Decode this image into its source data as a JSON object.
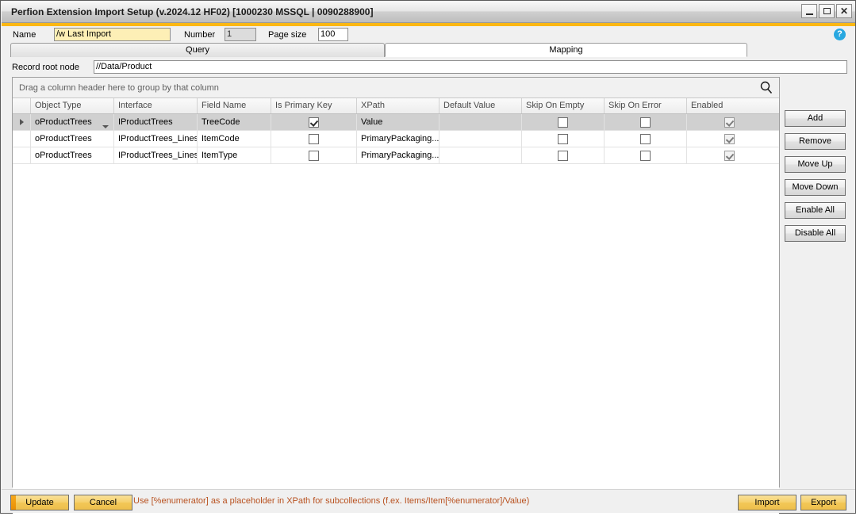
{
  "window": {
    "title": "Perfion Extension Import Setup (v.2024.12 HF02) [1000230 MSSQL | 0090288900]",
    "minimize_label": "Minimize",
    "maximize_label": "Maximize",
    "close_label": "✕",
    "accent_color": "#fbb713"
  },
  "toolbar": {
    "name_label": "Name",
    "name_value": "/w Last Import",
    "number_label": "Number",
    "number_value": "1",
    "page_size_label": "Page size",
    "page_size_value": "100",
    "help_label": "?"
  },
  "tabs": [
    {
      "label": "Query",
      "active": false
    },
    {
      "label": "Mapping",
      "active": true
    }
  ],
  "record_root": {
    "label": "Record root node",
    "value": "//Data/Product"
  },
  "grid": {
    "group_hint": "Drag a column header here to group by that column",
    "search_icon": "search-icon",
    "columns": [
      "Object Type",
      "Interface",
      "Field Name",
      "Is Primary Key",
      "XPath",
      "Default Value",
      "Skip On Empty",
      "Skip On Error",
      "Enabled"
    ],
    "rows": [
      {
        "selected": true,
        "object_type": "oProductTrees",
        "interface": "IProductTrees",
        "field_name": "TreeCode",
        "is_primary_key": true,
        "xpath": "Value",
        "default_value": "",
        "skip_on_empty": false,
        "skip_on_error": false,
        "enabled": true
      },
      {
        "selected": false,
        "object_type": "oProductTrees",
        "interface": "IProductTrees_Lines",
        "field_name": "ItemCode",
        "is_primary_key": false,
        "xpath": "PrimaryPackaging...",
        "default_value": "",
        "skip_on_empty": false,
        "skip_on_error": false,
        "enabled": true
      },
      {
        "selected": false,
        "object_type": "oProductTrees",
        "interface": "IProductTrees_Lines",
        "field_name": "ItemType",
        "is_primary_key": false,
        "xpath": "PrimaryPackaging...",
        "default_value": "",
        "skip_on_empty": false,
        "skip_on_error": false,
        "enabled": true
      }
    ]
  },
  "side_buttons": [
    {
      "label": "Add"
    },
    {
      "label": "Remove"
    },
    {
      "label": "Move Up"
    },
    {
      "label": "Move Down"
    },
    {
      "label": "Enable All"
    },
    {
      "label": "Disable All"
    }
  ],
  "footer": {
    "update_label": "Update",
    "cancel_label": "Cancel",
    "hint": "Use [%enumerator] as a placeholder in XPath for subcollections (f.ex. Items/Item[%enumerator]/Value)",
    "hint_color": "#b8511f",
    "import_label": "Import",
    "export_label": "Export"
  }
}
